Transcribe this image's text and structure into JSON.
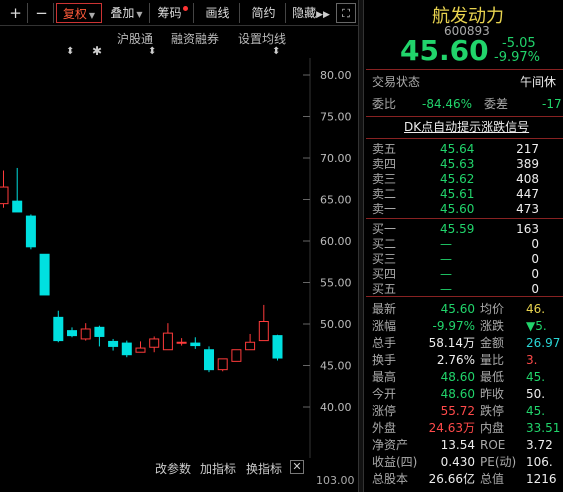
{
  "toolbar": {
    "plus_icon": "plus-icon",
    "minus_icon": "minus-icon",
    "fq_label": "复权",
    "overlay_label": "叠加",
    "chip_label": "筹码",
    "draw_label": "画线",
    "brief_label": "简约",
    "hide_label": "隐藏"
  },
  "subtoolbar": {
    "hsgt_label": "沪股通",
    "margin_label": "融资融券",
    "ma_label": "设置均线"
  },
  "chart": {
    "y_ticks": [
      "80.00",
      "75.00",
      "70.00",
      "65.00",
      "60.00",
      "55.00",
      "50.00",
      "45.00",
      "40.00"
    ],
    "bottom_value": "103.00"
  },
  "chart_data": {
    "type": "candlestick",
    "ylim": [
      40,
      80
    ],
    "up_color": "#ff3b3b",
    "down_color": "#00e0e0",
    "candles": [
      {
        "o": 64.5,
        "c": 66.5,
        "h": 68.5,
        "l": 64.0
      },
      {
        "o": 64.8,
        "c": 63.5,
        "h": 68.8,
        "l": 63.5
      },
      {
        "o": 63.0,
        "c": 59.3,
        "h": 63.2,
        "l": 59.0
      },
      {
        "o": 58.4,
        "c": 53.5,
        "h": 58.4,
        "l": 53.5
      },
      {
        "o": 50.8,
        "c": 48.0,
        "h": 51.6,
        "l": 47.8
      },
      {
        "o": 49.2,
        "c": 48.6,
        "h": 49.6,
        "l": 48.4
      },
      {
        "o": 48.2,
        "c": 49.4,
        "h": 50.1,
        "l": 48.0
      },
      {
        "o": 49.6,
        "c": 48.5,
        "h": 49.8,
        "l": 47.3
      },
      {
        "o": 47.9,
        "c": 47.3,
        "h": 48.2,
        "l": 46.8
      },
      {
        "o": 47.7,
        "c": 46.3,
        "h": 48.0,
        "l": 46.0
      },
      {
        "o": 46.6,
        "c": 47.1,
        "h": 47.9,
        "l": 46.6
      },
      {
        "o": 47.2,
        "c": 48.2,
        "h": 48.5,
        "l": 46.6
      },
      {
        "o": 46.9,
        "c": 48.9,
        "h": 50.1,
        "l": 46.9
      },
      {
        "o": 47.8,
        "c": 47.8,
        "h": 48.3,
        "l": 47.4
      },
      {
        "o": 47.7,
        "c": 47.4,
        "h": 48.4,
        "l": 47.0
      },
      {
        "o": 46.9,
        "c": 44.5,
        "h": 47.3,
        "l": 44.2
      },
      {
        "o": 44.5,
        "c": 45.8,
        "h": 45.8,
        "l": 44.3
      },
      {
        "o": 45.5,
        "c": 46.9,
        "h": 46.9,
        "l": 45.5
      },
      {
        "o": 46.9,
        "c": 47.8,
        "h": 48.8,
        "l": 46.9
      },
      {
        "o": 48.0,
        "c": 50.3,
        "h": 52.3,
        "l": 48.0
      },
      {
        "o": 48.6,
        "c": 45.9,
        "h": 48.7,
        "l": 45.6
      }
    ]
  },
  "bottom": {
    "params_label": "改参数",
    "add_indicator_label": "加指标",
    "switch_indicator_label": "换指标"
  },
  "panel": {
    "name": "航发动力",
    "code": "600893",
    "price": "45.60",
    "change": "-5.05",
    "change_pct": "-9.97%",
    "status_label": "交易状态",
    "status_value": "午间休",
    "wb_label": "委比",
    "wb_value": "-84.46%",
    "wc_label": "委差",
    "wc_value": "-17",
    "dk_label": "DK点自动提示涨跌信号",
    "sells": [
      {
        "label": "卖五",
        "price": "45.64",
        "vol": "217"
      },
      {
        "label": "卖四",
        "price": "45.63",
        "vol": "389"
      },
      {
        "label": "卖三",
        "price": "45.62",
        "vol": "408"
      },
      {
        "label": "卖二",
        "price": "45.61",
        "vol": "447"
      },
      {
        "label": "卖一",
        "price": "45.60",
        "vol": "473"
      }
    ],
    "buys": [
      {
        "label": "买一",
        "price": "45.59",
        "vol": "163"
      },
      {
        "label": "买二",
        "price": "—",
        "vol": "0"
      },
      {
        "label": "买三",
        "price": "—",
        "vol": "0"
      },
      {
        "label": "买四",
        "price": "—",
        "vol": "0"
      },
      {
        "label": "买五",
        "price": "—",
        "vol": "0"
      }
    ],
    "stats": [
      {
        "l1": "最新",
        "v1": "45.60",
        "c1": "green",
        "l2": "均价",
        "v2": "46.",
        "c2": "yellow"
      },
      {
        "l1": "涨幅",
        "v1": "-9.97%",
        "c1": "green",
        "l2": "涨跌",
        "v2": "▼5.",
        "c2": "green"
      },
      {
        "l1": "总手",
        "v1": "58.14万",
        "c1": "white",
        "l2": "金额",
        "v2": "26.97",
        "c2": "cyan"
      },
      {
        "l1": "换手",
        "v1": "2.76%",
        "c1": "white",
        "l2": "量比",
        "v2": "3.",
        "c2": "red"
      },
      {
        "l1": "最高",
        "v1": "48.60",
        "c1": "green",
        "l2": "最低",
        "v2": "45.",
        "c2": "green"
      },
      {
        "l1": "今开",
        "v1": "48.60",
        "c1": "green",
        "l2": "昨收",
        "v2": "50.",
        "c2": "white"
      },
      {
        "l1": "涨停",
        "v1": "55.72",
        "c1": "red",
        "l2": "跌停",
        "v2": "45.",
        "c2": "green"
      },
      {
        "l1": "外盘",
        "v1": "24.63万",
        "c1": "red",
        "l2": "内盘",
        "v2": "33.51",
        "c2": "green"
      },
      {
        "l1": "净资产",
        "v1": "13.54",
        "c1": "white",
        "l2": "ROE",
        "v2": "3.72",
        "c2": "white"
      },
      {
        "l1": "收益(四)",
        "v1": "0.430",
        "c1": "white",
        "l2": "PE(动)",
        "v2": "106.",
        "c2": "white"
      },
      {
        "l1": "总股本",
        "v1": "26.66亿",
        "c1": "white",
        "l2": "总值",
        "v2": "1216",
        "c2": "white"
      }
    ]
  }
}
